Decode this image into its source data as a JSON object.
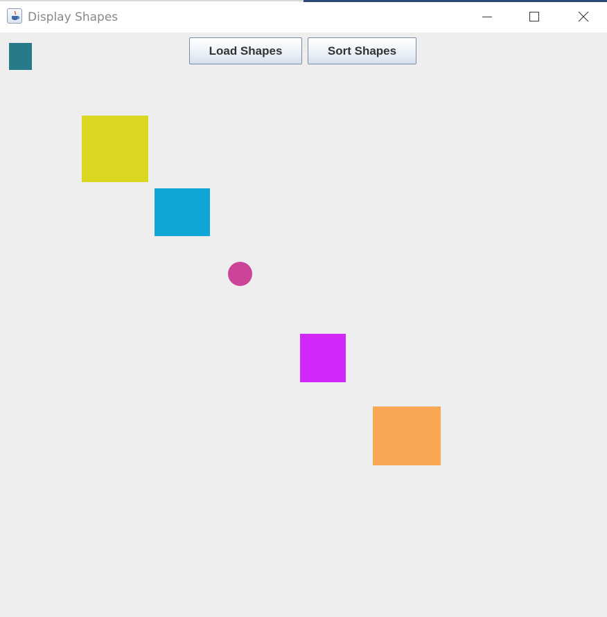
{
  "window": {
    "title": "Display Shapes",
    "app_icon": "java-cup-icon",
    "controls": {
      "minimize_icon": "minimize-icon",
      "maximize_icon": "maximize-icon",
      "close_icon": "close-icon"
    }
  },
  "toolbar": {
    "load_label": "Load Shapes",
    "sort_label": "Sort Shapes"
  },
  "colors": {
    "panel_background": "#eeeeee",
    "title_text": "#888888"
  },
  "shapes": [
    {
      "kind": "rectangle",
      "color": "#267a8a"
    },
    {
      "kind": "square",
      "color": "#dad720"
    },
    {
      "kind": "rectangle",
      "color": "#10a6d6"
    },
    {
      "kind": "circle",
      "color": "#cc4498"
    },
    {
      "kind": "rectangle",
      "color": "#cf28f8"
    },
    {
      "kind": "rectangle",
      "color": "#f8a853"
    }
  ]
}
